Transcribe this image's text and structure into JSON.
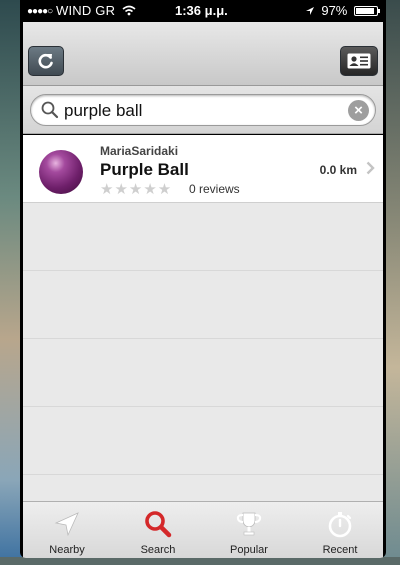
{
  "status_bar": {
    "signal": "●●●●○",
    "carrier": "WIND GR",
    "time": "1:36 μ.μ.",
    "battery": "97%"
  },
  "search": {
    "query": "purple ball",
    "clear_label": "×"
  },
  "results": [
    {
      "owner": "MariaSaridaki",
      "title": "Purple Ball",
      "rating": 0,
      "stars": "★★★★★",
      "reviews": "0 reviews",
      "distance": "0.0 km"
    }
  ],
  "tabs": [
    {
      "label": "Nearby",
      "icon": "location-arrow-icon"
    },
    {
      "label": "Search",
      "icon": "search-icon",
      "active": true
    },
    {
      "label": "Popular",
      "icon": "trophy-icon"
    },
    {
      "label": "Recent",
      "icon": "stopwatch-icon"
    }
  ],
  "colors": {
    "active_tab": "#d4282a",
    "inactive_icon": "#ffffff",
    "nav_button": "#404a52"
  }
}
